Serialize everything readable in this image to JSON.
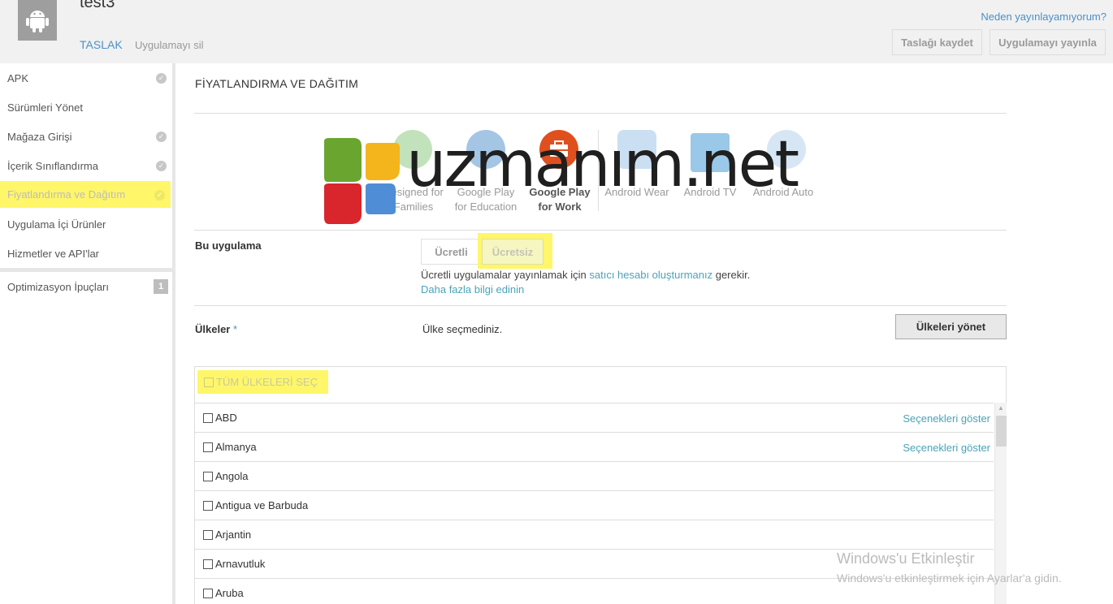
{
  "header": {
    "app_title": "test3",
    "status_tab": "TASLAK",
    "delete_link": "Uygulamayı sil",
    "why_link": "Neden yayınlayamıyorum?",
    "save_draft_label": "Taslağı kaydet",
    "publish_label": "Uygulamayı yayınla",
    "app_icon": "android-icon"
  },
  "sidebar": {
    "items": [
      {
        "label": "APK",
        "complete": true
      },
      {
        "label": "Sürümleri Yönet",
        "complete": false
      },
      {
        "label": "Mağaza Girişi",
        "complete": true
      },
      {
        "label": "İçerik Sınıflandırma",
        "complete": true
      },
      {
        "label": "Fiyatlandırma ve Dağıtım",
        "complete": true,
        "active": true
      },
      {
        "label": "Uygulama İçi Ürünler",
        "complete": false
      },
      {
        "label": "Hizmetler ve API'lar",
        "complete": false
      }
    ],
    "tips": {
      "label": "Optimizasyon İpuçları",
      "count": "1"
    }
  },
  "main": {
    "section_title": "FİYATLANDIRMA VE DAĞITIM",
    "programs": [
      {
        "line1": "Designed for",
        "line2": "Families",
        "icon": "families-icon",
        "bold": false
      },
      {
        "line1": "Google Play",
        "line2": "for Education",
        "icon": "education-icon",
        "bold": false
      },
      {
        "line1": "Google Play",
        "line2": "for Work",
        "icon": "work-icon",
        "bold": true
      },
      {
        "line1": "Android Wear",
        "line2": "",
        "icon": "watch-icon",
        "bold": false
      },
      {
        "line1": "Android TV",
        "line2": "",
        "icon": "tv-icon",
        "bold": false
      },
      {
        "line1": "Android Auto",
        "line2": "",
        "icon": "car-icon",
        "bold": false
      }
    ],
    "watermark_logo": "uzmanım.net",
    "pricing": {
      "label": "Bu uygulama",
      "paid": "Ücretli",
      "free": "Ücretsiz",
      "info_prefix": "Ücretli uygulamalar yayınlamak için ",
      "info_link": "satıcı hesabı oluşturmanız",
      "info_suffix": " gerekir.",
      "more_link": "Daha fazla bilgi edinin"
    },
    "countries": {
      "label": "Ülkeler",
      "required_mark": "*",
      "none_selected": "Ülke seçmediniz.",
      "manage_button": "Ülkeleri yönet",
      "select_all": "TÜM ÜLKELERİ SEÇ",
      "list": [
        {
          "name": "ABD",
          "options": "Seçenekleri göster"
        },
        {
          "name": "Almanya",
          "options": "Seçenekleri göster"
        },
        {
          "name": "Angola",
          "options": ""
        },
        {
          "name": "Antigua ve Barbuda",
          "options": ""
        },
        {
          "name": "Arjantin",
          "options": ""
        },
        {
          "name": "Arnavutluk",
          "options": ""
        },
        {
          "name": "Aruba",
          "options": ""
        }
      ]
    }
  },
  "activation": {
    "title": "Windows'u Etkinleştir",
    "subtitle": "Windows'u etkinleştirmek için Ayarlar'a gidin."
  },
  "colors": {
    "highlight": "#fff66a",
    "link": "#4a90c8",
    "work_red": "#e0501f"
  }
}
